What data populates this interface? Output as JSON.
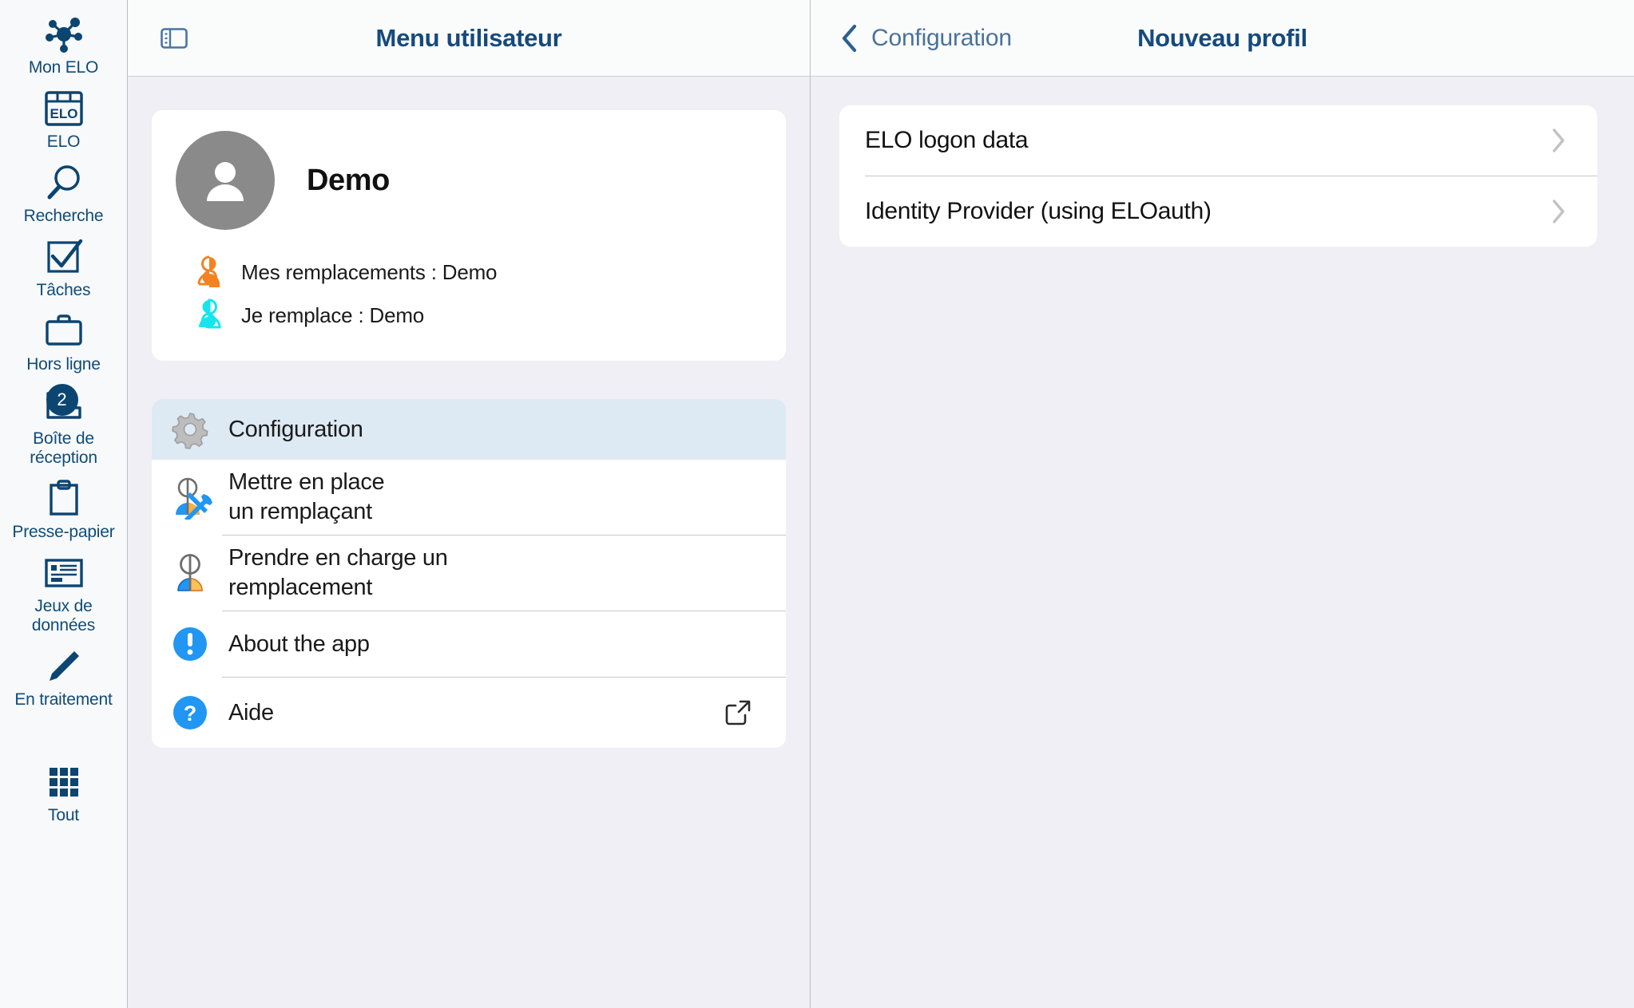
{
  "sidebar": {
    "items": [
      {
        "label": "Mon ELO",
        "icon": "network-hub-icon",
        "badge": null
      },
      {
        "label": "ELO",
        "icon": "elo-archive-icon",
        "badge": null
      },
      {
        "label": "Recherche",
        "icon": "search-icon",
        "badge": null
      },
      {
        "label": "Tâches",
        "icon": "checkbox-check-icon",
        "badge": null
      },
      {
        "label": "Hors ligne",
        "icon": "briefcase-icon",
        "badge": null
      },
      {
        "label": "Boîte de\nréception",
        "icon": "inbox-tray-icon",
        "badge": "2"
      },
      {
        "label": "Presse-papier",
        "icon": "clipboard-icon",
        "badge": null
      },
      {
        "label": "Jeux de\ndonnées",
        "icon": "data-sets-icon",
        "badge": null
      },
      {
        "label": "En traitement",
        "icon": "pencil-icon",
        "badge": null
      },
      {
        "label": "Tout",
        "icon": "grid-apps-icon",
        "badge": null
      }
    ]
  },
  "middle": {
    "header": {
      "panel_toggle_icon": "side-panel-toggle-icon",
      "title": "Menu utilisateur"
    },
    "profile": {
      "avatar_icon": "user-avatar-icon",
      "name": "Demo",
      "rows": [
        {
          "icon": "substitute-orange-icon",
          "text": "Mes remplacements : Demo"
        },
        {
          "icon": "substitute-cyan-icon",
          "text": "Je remplace : Demo"
        }
      ]
    },
    "menu": [
      {
        "label": "Configuration",
        "icon": "gear-icon",
        "selected": true,
        "action_icon": null
      },
      {
        "label": "Mettre en place\nun remplaçant",
        "icon": "set-substitute-icon",
        "selected": false,
        "action_icon": null
      },
      {
        "label": "Prendre en charge un\nremplacement",
        "icon": "take-substitution-icon",
        "selected": false,
        "action_icon": null
      },
      {
        "label": "About the app",
        "icon": "info-exclamation-icon",
        "selected": false,
        "action_icon": null
      },
      {
        "label": "Aide",
        "icon": "help-question-icon",
        "selected": false,
        "action_icon": "external-link-icon"
      }
    ]
  },
  "right": {
    "header": {
      "back_icon": "chevron-left-icon",
      "back_label": "Configuration",
      "title": "Nouveau profil"
    },
    "list": [
      {
        "label": "ELO logon data",
        "chevron": "chevron-right-icon"
      },
      {
        "label": "Identity Provider (using ELOauth)",
        "chevron": "chevron-right-icon"
      }
    ]
  },
  "colors": {
    "brand_navy": "#0b4571",
    "header_title": "#154a7c",
    "back_link": "#49729b",
    "selected_row": "#dde9f3",
    "content_bg": "#f0eff5",
    "badge_bg": "#0b4571",
    "substitute_orange": "#f58220",
    "substitute_cyan": "#16e5f0",
    "info_blue": "#2196f3"
  }
}
